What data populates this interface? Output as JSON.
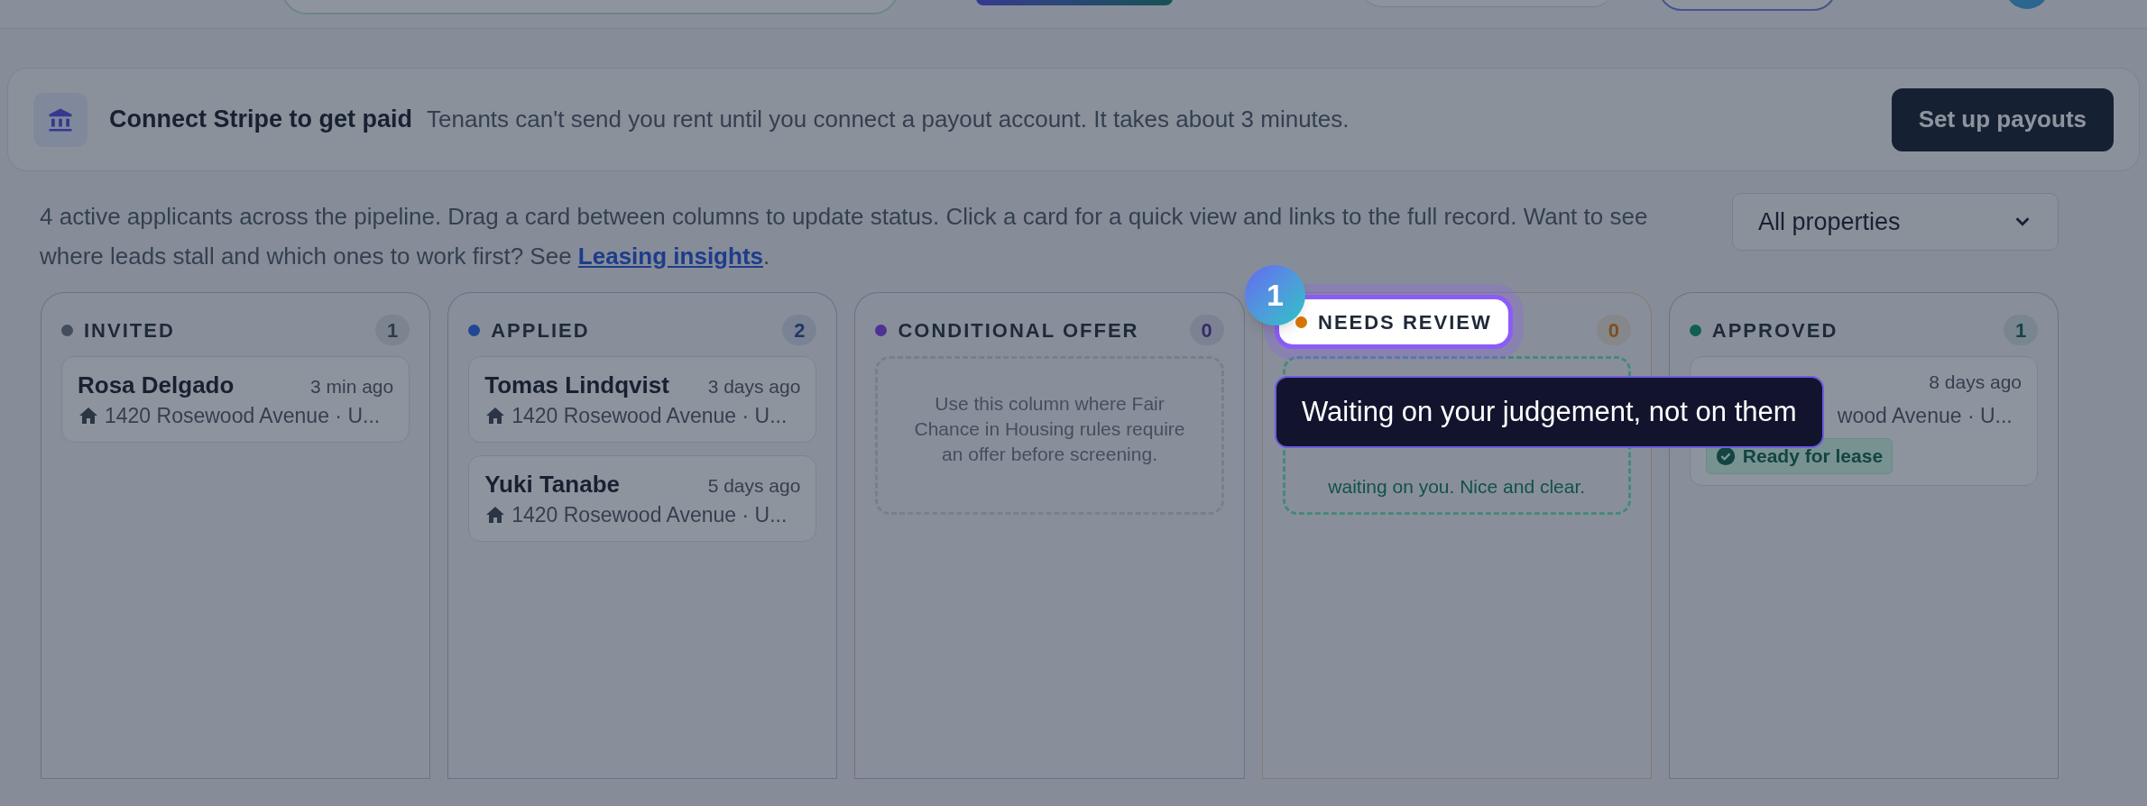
{
  "banner": {
    "title": "Connect Stripe to get paid",
    "message": "Tenants can't send you rent until you connect a payout account. It takes about 3 minutes.",
    "button": "Set up payouts"
  },
  "intro": {
    "text": "4 active applicants across the pipeline. Drag a card between columns to update status. Click a card for a quick view and links to the full record. Want to see where leads stall and which ones to work first? See ",
    "link": "Leasing insights",
    "after": "."
  },
  "property_filter": {
    "value": "All properties"
  },
  "columns": [
    {
      "title": "INVITED",
      "count": "1",
      "color": "#444d5d",
      "cards": [
        {
          "name": "Rosa Delgado",
          "time": "3 min ago",
          "address": "1420 Rosewood Avenue · U..."
        }
      ]
    },
    {
      "title": "APPLIED",
      "count": "2",
      "color": "#214693",
      "cards": [
        {
          "name": "Tomas Lindqvist",
          "time": "3 days ago",
          "address": "1420 Rosewood Avenue · U..."
        },
        {
          "name": "Yuki Tanabe",
          "time": "5 days ago",
          "address": "1420 Rosewood Avenue · U..."
        }
      ]
    },
    {
      "title": "CONDITIONAL OFFER",
      "count": "0",
      "color": "#4d3194",
      "empty_text": "Use this column where Fair Chance in Housing rules require an offer before screening."
    },
    {
      "title": "NEEDS REVIEW",
      "count": "0",
      "color": "#d97706",
      "highlighted": true,
      "empty_text": "waiting on you. Nice and clear."
    },
    {
      "title": "APPROVED",
      "count": "1",
      "color": "#115f52",
      "cards": [
        {
          "time": "8 days ago",
          "address": "wood Avenue · U...",
          "badge": "Ready for lease"
        }
      ]
    }
  ],
  "tour": {
    "step": "1",
    "tooltip": "Waiting on your judgement, not on them"
  }
}
